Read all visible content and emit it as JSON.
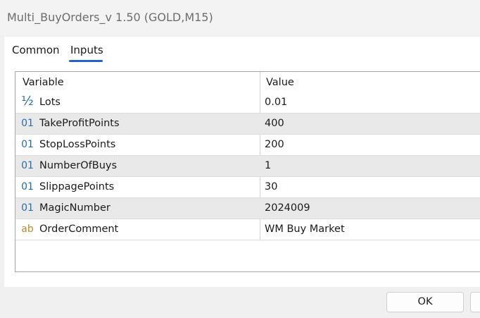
{
  "window": {
    "title": "Multi_BuyOrders_v 1.50 (GOLD,M15)"
  },
  "tabs": [
    {
      "label": "Common"
    },
    {
      "label": "Inputs"
    }
  ],
  "grid": {
    "columns": [
      "Variable",
      "Value"
    ],
    "rows": [
      {
        "icon": "half-fraction-icon",
        "icon_text": "½",
        "name": "Lots",
        "value": "0.01"
      },
      {
        "icon": "integer-type-icon",
        "icon_text": "01",
        "name": "TakeProfitPoints",
        "value": "400"
      },
      {
        "icon": "integer-type-icon",
        "icon_text": "01",
        "name": "StopLossPoints",
        "value": "200"
      },
      {
        "icon": "integer-type-icon",
        "icon_text": "01",
        "name": "NumberOfBuys",
        "value": "1"
      },
      {
        "icon": "integer-type-icon",
        "icon_text": "01",
        "name": "SlippagePoints",
        "value": "30"
      },
      {
        "icon": "integer-type-icon",
        "icon_text": "01",
        "name": "MagicNumber",
        "value": "2024009"
      },
      {
        "icon": "string-type-icon",
        "icon_text": "ab",
        "name": "OrderComment",
        "value": "WM Buy Market"
      }
    ]
  },
  "buttons": {
    "ok_label": "OK"
  },
  "colors": {
    "accent": "#1f66c7",
    "integer_icon": "#2a6bb8",
    "string_icon": "#c08a2a",
    "alt_row": "#e9e9e9"
  }
}
